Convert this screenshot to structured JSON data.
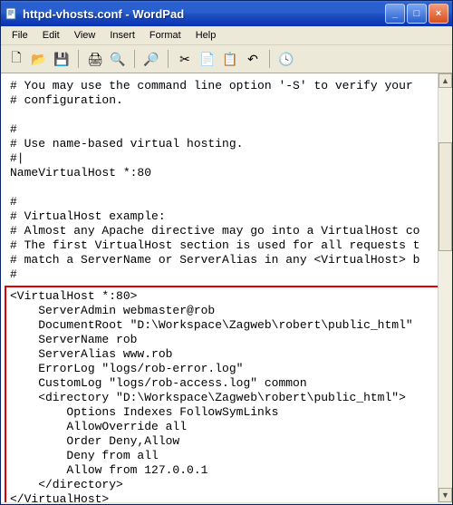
{
  "titlebar": {
    "title": "httpd-vhosts.conf - WordPad"
  },
  "menubar": {
    "items": [
      "File",
      "Edit",
      "View",
      "Insert",
      "Format",
      "Help"
    ]
  },
  "toolbar": {
    "icons": [
      {
        "name": "new-icon",
        "glyph": "🗋"
      },
      {
        "name": "open-icon",
        "glyph": "📂"
      },
      {
        "name": "save-icon",
        "glyph": "💾"
      },
      {
        "name": "sep"
      },
      {
        "name": "print-icon",
        "glyph": "🖨"
      },
      {
        "name": "print-preview-icon",
        "glyph": "🔍"
      },
      {
        "name": "sep"
      },
      {
        "name": "find-icon",
        "glyph": "🔎"
      },
      {
        "name": "sep"
      },
      {
        "name": "cut-icon",
        "glyph": "✂"
      },
      {
        "name": "copy-icon",
        "glyph": "📄"
      },
      {
        "name": "paste-icon",
        "glyph": "📋"
      },
      {
        "name": "undo-icon",
        "glyph": "↶"
      },
      {
        "name": "sep"
      },
      {
        "name": "datetime-icon",
        "glyph": "🕓"
      }
    ]
  },
  "document": {
    "upper": [
      "# You may use the command line option '-S' to verify your ",
      "# configuration.",
      "",
      "#",
      "# Use name-based virtual hosting.",
      "#|",
      "NameVirtualHost *:80",
      "",
      "#",
      "# VirtualHost example:",
      "# Almost any Apache directive may go into a VirtualHost co",
      "# The first VirtualHost section is used for all requests t",
      "# match a ServerName or ServerAlias in any <VirtualHost> b",
      "#"
    ],
    "vhost": [
      "<VirtualHost *:80>",
      "    ServerAdmin webmaster@rob",
      "    DocumentRoot \"D:\\Workspace\\Zagweb\\robert\\public_html\"",
      "    ServerName rob",
      "    ServerAlias www.rob",
      "    ErrorLog \"logs/rob-error.log\"",
      "    CustomLog \"logs/rob-access.log\" common",
      "    <directory \"D:\\Workspace\\Zagweb\\robert\\public_html\">",
      "        Options Indexes FollowSymLinks",
      "        AllowOverride all",
      "        Order Deny,Allow",
      "        Deny from all",
      "        Allow from 127.0.0.1",
      "    </directory>",
      "</VirtualHost>"
    ]
  },
  "winbtns": {
    "min": "_",
    "max": "□",
    "close": "×"
  }
}
